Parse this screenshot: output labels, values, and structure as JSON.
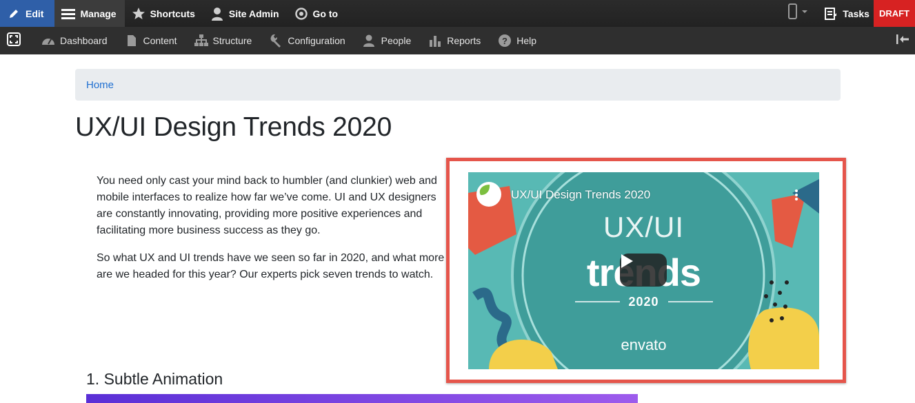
{
  "toolbar": {
    "edit": "Edit",
    "manage": "Manage",
    "shortcuts": "Shortcuts",
    "site_admin": "Site Admin",
    "goto": "Go to",
    "tasks": "Tasks",
    "draft": "DRAFT"
  },
  "subnav": {
    "items": [
      {
        "label": "Dashboard",
        "icon": "dashboard-icon"
      },
      {
        "label": "Content",
        "icon": "page-icon"
      },
      {
        "label": "Structure",
        "icon": "structure-icon"
      },
      {
        "label": "Configuration",
        "icon": "wrench-icon"
      },
      {
        "label": "People",
        "icon": "people-icon"
      },
      {
        "label": "Reports",
        "icon": "bar-chart-icon"
      },
      {
        "label": "Help",
        "icon": "help-icon"
      }
    ]
  },
  "breadcrumb": {
    "home": "Home"
  },
  "page": {
    "title": "UX/UI Design Trends 2020",
    "paragraphs": [
      "You need only cast your mind back to humbler (and clunkier) web and mobile interfaces to realize how far we’ve come. UI and UX designers are constantly innovating, providing more positive experiences and facilitating more business success as they go.",
      "So what UX and UI trends have we seen so far in 2020, and what more are we headed for this year? Our experts pick seven trends to watch."
    ],
    "section_heading": "1. Subtle Animation"
  },
  "video": {
    "title": "UX/UI Design Trends 2020",
    "line1": "UX/UI",
    "line2": "trends",
    "year": "2020",
    "brand": "envato"
  },
  "colors": {
    "edit_bg": "#2f5fa8",
    "draft_bg": "#d72222",
    "highlight": "#e5554b",
    "link": "#1f6fd1"
  }
}
